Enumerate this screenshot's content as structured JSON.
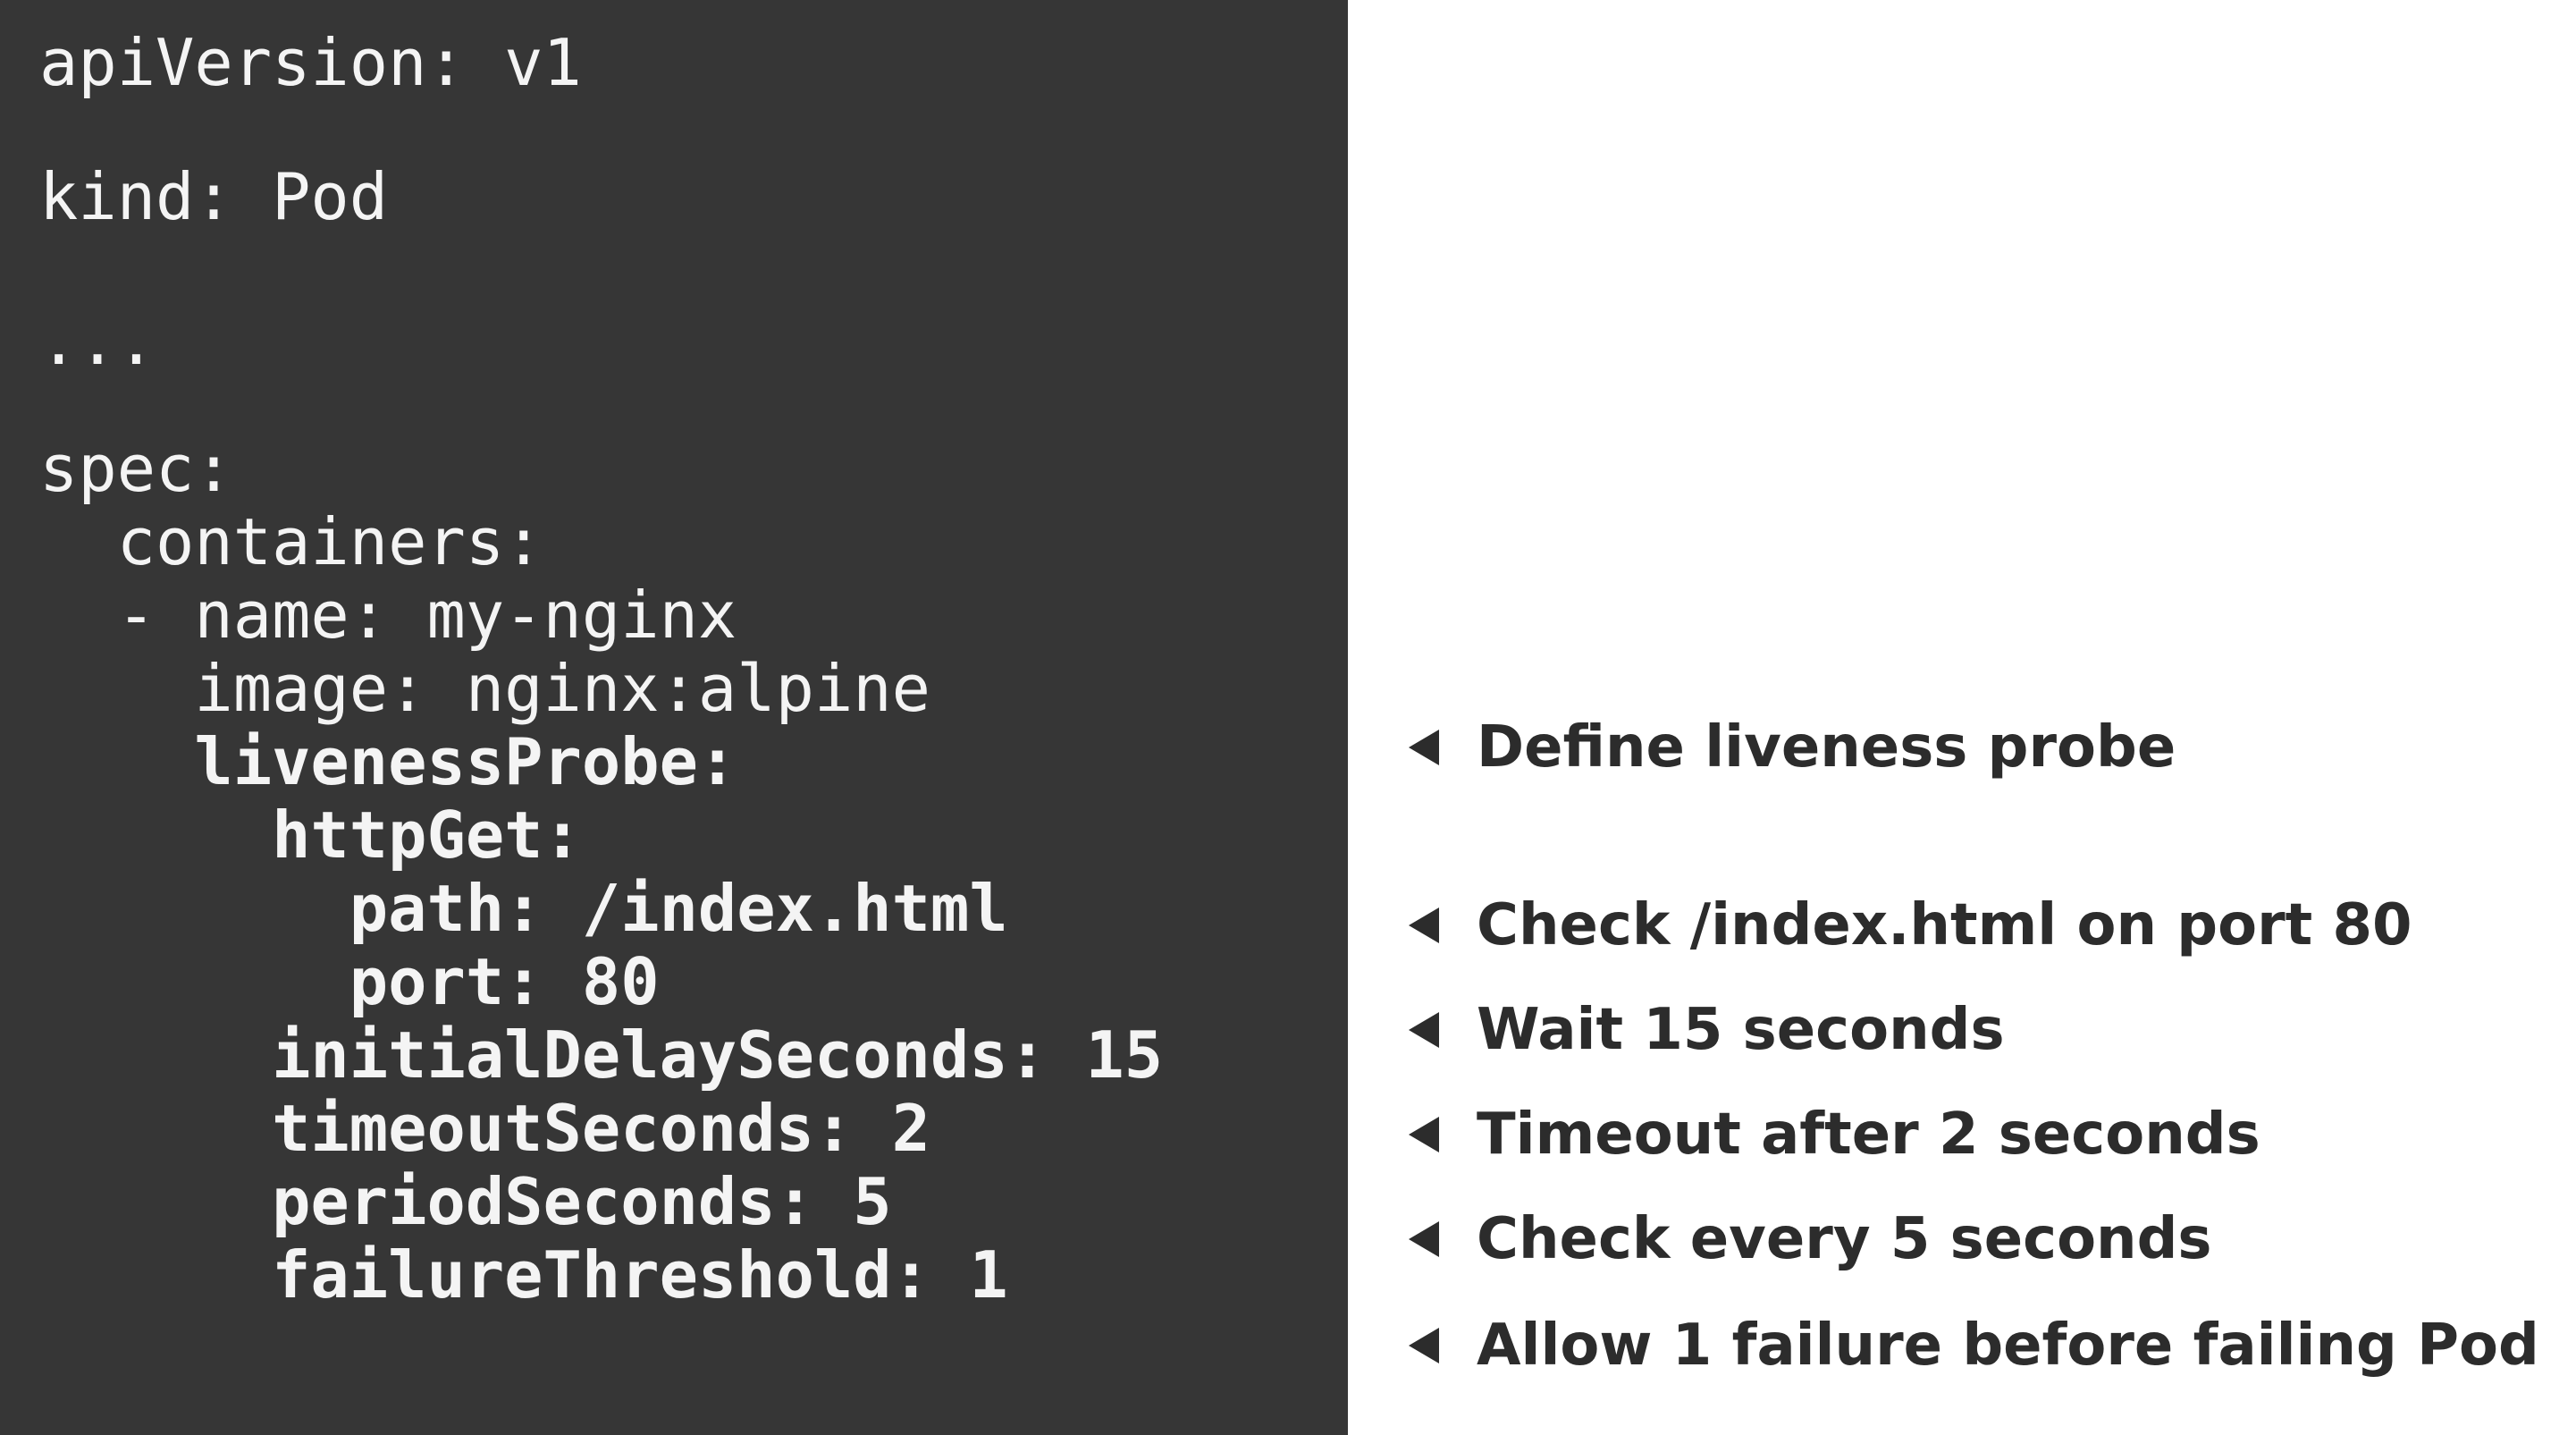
{
  "code": {
    "lines": [
      "apiVersion: v1",
      "kind: Pod",
      "...",
      "spec:",
      "  containers:",
      "  - name: my-nginx",
      "    image: nginx:alpine",
      "    livenessProbe:",
      "      httpGet:",
      "        path: /index.html",
      "        port: 80",
      "      initialDelaySeconds: 15",
      "      timeoutSeconds: 2",
      "      periodSeconds: 5",
      "      failureThreshold: 1"
    ]
  },
  "notes": [
    "Define liveness probe",
    "Check /index.html on port 80",
    "Wait 15 seconds",
    "Timeout after 2 seconds",
    "Check every 5 seconds",
    "Allow 1 failure before failing Pod"
  ],
  "colors": {
    "code_background": "#363636",
    "code_text": "#f4f4f4",
    "note_text": "#2c2c2c",
    "page_background": "#ffffff"
  },
  "icons": {
    "note_marker": "left-triangle-arrow-icon"
  }
}
